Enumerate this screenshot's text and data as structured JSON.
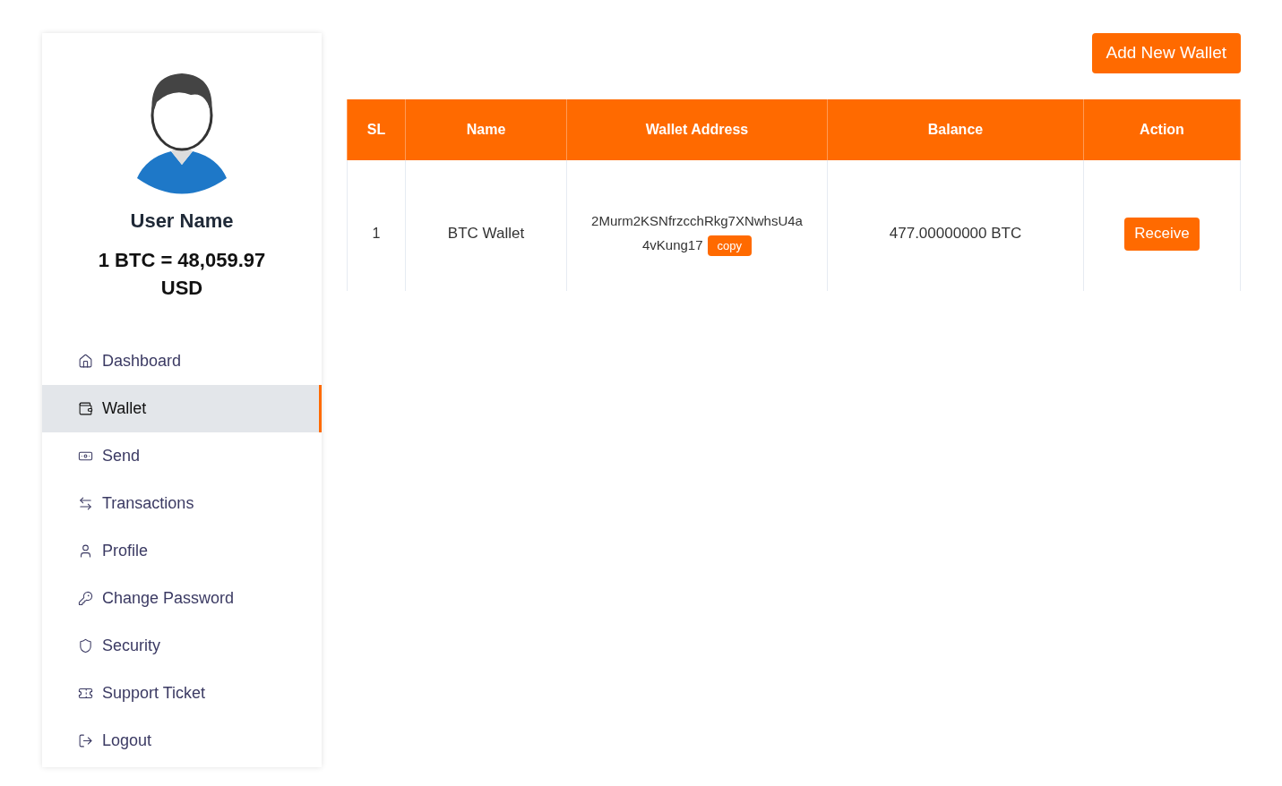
{
  "profile": {
    "name": "User Name",
    "rate": "1 BTC = 48,059.97 USD"
  },
  "sidebar": {
    "items": [
      {
        "kind": "home",
        "label": "Dashboard",
        "selected": false
      },
      {
        "kind": "wallet",
        "label": "Wallet",
        "selected": true
      },
      {
        "kind": "send",
        "label": "Send",
        "selected": false
      },
      {
        "kind": "transactions",
        "label": "Transactions",
        "selected": false
      },
      {
        "kind": "profile",
        "label": "Profile",
        "selected": false
      },
      {
        "kind": "password",
        "label": "Change Password",
        "selected": false
      },
      {
        "kind": "security",
        "label": "Security",
        "selected": false
      },
      {
        "kind": "ticket",
        "label": "Support Ticket",
        "selected": false
      },
      {
        "kind": "logout",
        "label": "Logout",
        "selected": false
      }
    ]
  },
  "add_button": "Add New Wallet",
  "table": {
    "columns": [
      "SL",
      "Name",
      "Wallet Address",
      "Balance",
      "Action"
    ],
    "rows": [
      {
        "sl": "1",
        "name": "BTC Wallet",
        "address_lines": [
          "2Murm2KSNfrzcchRkg7XNwhsU4a",
          "4vKung17"
        ],
        "copy": "copy",
        "balance": "477.00000000 BTC",
        "action": "Receive"
      }
    ]
  }
}
